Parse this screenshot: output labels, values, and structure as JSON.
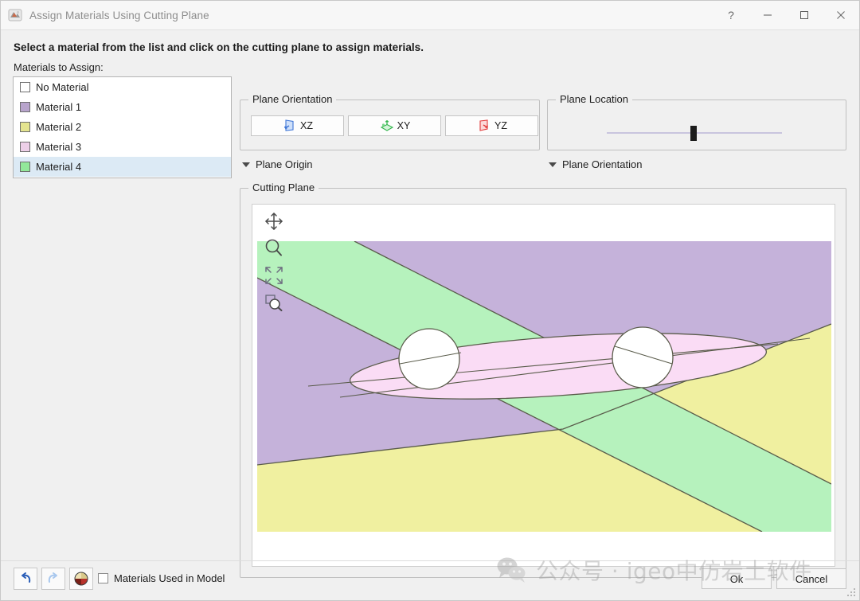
{
  "window": {
    "title": "Assign Materials Using Cutting Plane",
    "app_icon": "app-icon",
    "controls": {
      "help": "?",
      "minimize": "minimize-icon",
      "maximize": "maximize-icon",
      "close": "close-icon"
    }
  },
  "instruction": "Select a material from the list and click on the cutting plane to assign materials.",
  "materials": {
    "label": "Materials to Assign:",
    "items": [
      {
        "name": "No Material",
        "color": "#ffffff",
        "selected": false
      },
      {
        "name": "Material 1",
        "color": "#b8a4cc",
        "selected": false
      },
      {
        "name": "Material 2",
        "color": "#e4e48f",
        "selected": false
      },
      {
        "name": "Material 3",
        "color": "#edcfe8",
        "selected": false
      },
      {
        "name": "Material 4",
        "color": "#92e89a",
        "selected": true
      }
    ]
  },
  "plane_orientation": {
    "group_label": "Plane Orientation",
    "buttons": [
      {
        "label": "XZ",
        "icon": "plane-xz-icon",
        "color": "#3f76d6"
      },
      {
        "label": "XY",
        "icon": "plane-xy-icon",
        "color": "#30b44a"
      },
      {
        "label": "YZ",
        "icon": "plane-yz-icon",
        "color": "#e23b3b"
      }
    ]
  },
  "plane_location": {
    "group_label": "Plane Location",
    "slider_value_percent": 48
  },
  "collapsibles": [
    {
      "label": "Plane Origin",
      "expanded": false
    },
    {
      "label": "Plane Orientation",
      "expanded": false
    }
  ],
  "cutting_plane": {
    "group_label": "Cutting Plane",
    "tools": [
      {
        "name": "pan-icon",
        "title": "Pan"
      },
      {
        "name": "zoom-icon",
        "title": "Zoom"
      },
      {
        "name": "zoom-extents-icon",
        "title": "Zoom Extents"
      },
      {
        "name": "zoom-window-icon",
        "title": "Zoom Window"
      }
    ],
    "colors": {
      "purple": "#c5b2da",
      "green": "#b6f2bd",
      "yellow": "#f0f0a0",
      "pink": "#fadcf5",
      "white": "#ffffff",
      "outline": "#595b4a"
    }
  },
  "footer": {
    "undo": "undo-icon",
    "redo": "redo-icon",
    "material_sphere": "material-sphere-icon",
    "checkbox_label": "Materials Used in Model",
    "checkbox_checked": false,
    "ok_label": "Ok",
    "cancel_label": "Cancel"
  },
  "watermark": {
    "logo": "wechat-icon",
    "text": "公众号 · igeo中仿岩土软件"
  }
}
